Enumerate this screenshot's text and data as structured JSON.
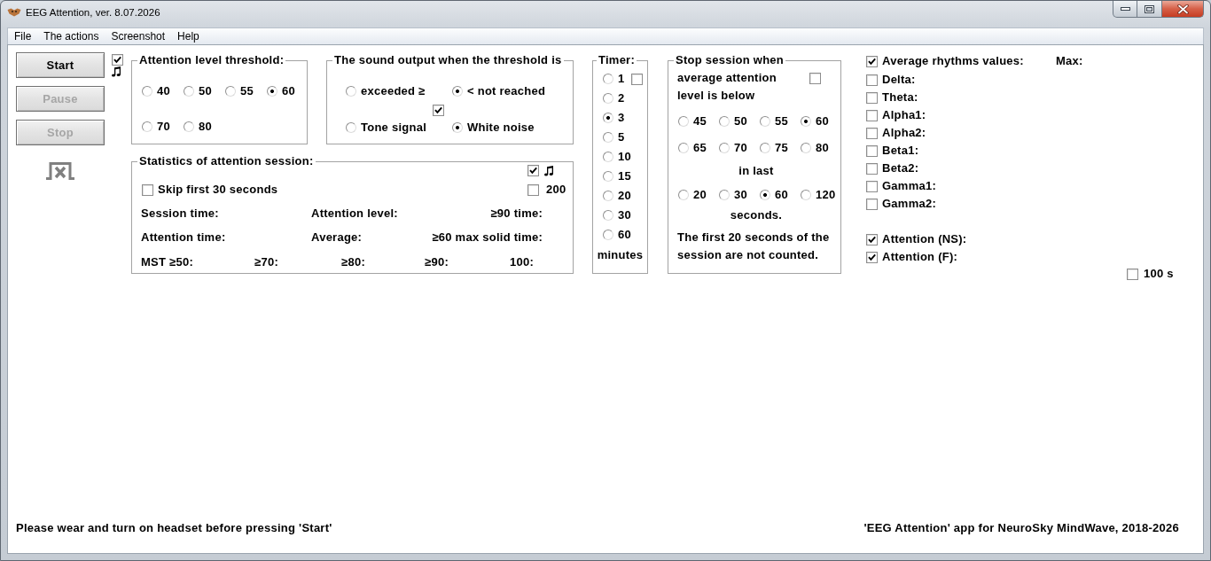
{
  "window": {
    "title": "EEG Attention, ver. 8.07.2026"
  },
  "menu": [
    {
      "label": "File"
    },
    {
      "label": "The actions"
    },
    {
      "label": "Screenshot"
    },
    {
      "label": "Help"
    }
  ],
  "buttons": [
    {
      "label": "Start",
      "disabled": false
    },
    {
      "label": "Pause",
      "disabled": true
    },
    {
      "label": "Stop",
      "disabled": true
    }
  ],
  "sound_checkbox": {
    "checked": true
  },
  "threshold": {
    "title": "Attention level threshold:",
    "options": [
      {
        "label": "40",
        "selected": false
      },
      {
        "label": "50",
        "selected": false
      },
      {
        "label": "55",
        "selected": false
      },
      {
        "label": "60",
        "selected": true
      },
      {
        "label": "70",
        "selected": false
      },
      {
        "label": "80",
        "selected": false
      }
    ]
  },
  "sound_output": {
    "title": "The sound output when the threshold is",
    "conditions": [
      {
        "label": "exceeded ≥",
        "selected": false
      },
      {
        "label": "< not reached",
        "selected": true
      }
    ],
    "checkbox": {
      "checked": true
    },
    "signals": [
      {
        "label": "Tone signal",
        "selected": false
      },
      {
        "label": "White noise",
        "selected": true
      }
    ]
  },
  "statistics": {
    "title": "Statistics of attention session:",
    "sound_checkbox": {
      "checked": true
    },
    "skip": {
      "label": "Skip first 30 seconds",
      "checked": false
    },
    "limit": {
      "label": "200",
      "checked": false
    },
    "rows": [
      [
        "Session time:",
        "Attention level:",
        "≥90 time:"
      ],
      [
        "Attention time:",
        "Average:",
        "≥60 max solid time:"
      ]
    ],
    "mst_row": [
      "MST ≥50:",
      "≥70:",
      "≥80:",
      "≥90:",
      "100:"
    ]
  },
  "timer": {
    "title": "Timer:",
    "options": [
      {
        "label": "1",
        "selected": false
      },
      {
        "label": "2",
        "selected": false
      },
      {
        "label": "3",
        "selected": true
      },
      {
        "label": "5",
        "selected": false
      },
      {
        "label": "10",
        "selected": false
      },
      {
        "label": "15",
        "selected": false
      },
      {
        "label": "20",
        "selected": false
      },
      {
        "label": "30",
        "selected": false
      },
      {
        "label": "60",
        "selected": false
      }
    ],
    "checkbox": {
      "checked": false
    },
    "unit": "minutes"
  },
  "stop_session": {
    "title": "Stop session when",
    "condition": "average attention level is below",
    "checkbox": {
      "checked": false
    },
    "levels": [
      {
        "label": "45",
        "selected": false
      },
      {
        "label": "50",
        "selected": false
      },
      {
        "label": "55",
        "selected": false
      },
      {
        "label": "60",
        "selected": true
      },
      {
        "label": "65",
        "selected": false
      },
      {
        "label": "70",
        "selected": false
      },
      {
        "label": "75",
        "selected": false
      },
      {
        "label": "80",
        "selected": false
      }
    ],
    "period_label": "in last",
    "periods": [
      {
        "label": "20",
        "selected": false
      },
      {
        "label": "30",
        "selected": false
      },
      {
        "label": "60",
        "selected": true
      },
      {
        "label": "120",
        "selected": false
      }
    ],
    "period_unit": "seconds.",
    "note": "The first 20 seconds of the session are not counted."
  },
  "rhythms": {
    "header": {
      "label": "Average rhythms values:",
      "checked": true
    },
    "max_label": "Max:",
    "items": [
      {
        "label": "Delta:",
        "checked": false
      },
      {
        "label": "Theta:",
        "checked": false
      },
      {
        "label": "Alpha1:",
        "checked": false
      },
      {
        "label": "Alpha2:",
        "checked": false
      },
      {
        "label": "Beta1:",
        "checked": false
      },
      {
        "label": "Beta2:",
        "checked": false
      },
      {
        "label": "Gamma1:",
        "checked": false
      },
      {
        "label": "Gamma2:",
        "checked": false
      }
    ],
    "attention": [
      {
        "label": "Attention (NS):",
        "checked": true
      },
      {
        "label": "Attention (F):",
        "checked": true
      }
    ],
    "window": {
      "label": "100 s",
      "checked": false
    }
  },
  "status_bar": {
    "left": "Please wear and turn on headset before pressing 'Start'",
    "right": "'EEG Attention' app for NeuroSky MindWave, 2018-2026"
  }
}
